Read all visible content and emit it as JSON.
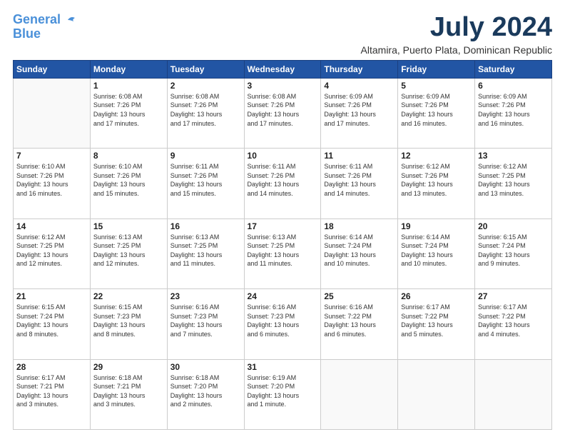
{
  "header": {
    "logo_line1": "General",
    "logo_line2": "Blue",
    "month": "July 2024",
    "location": "Altamira, Puerto Plata, Dominican Republic"
  },
  "weekdays": [
    "Sunday",
    "Monday",
    "Tuesday",
    "Wednesday",
    "Thursday",
    "Friday",
    "Saturday"
  ],
  "weeks": [
    [
      {
        "day": "",
        "info": ""
      },
      {
        "day": "1",
        "info": "Sunrise: 6:08 AM\nSunset: 7:26 PM\nDaylight: 13 hours\nand 17 minutes."
      },
      {
        "day": "2",
        "info": "Sunrise: 6:08 AM\nSunset: 7:26 PM\nDaylight: 13 hours\nand 17 minutes."
      },
      {
        "day": "3",
        "info": "Sunrise: 6:08 AM\nSunset: 7:26 PM\nDaylight: 13 hours\nand 17 minutes."
      },
      {
        "day": "4",
        "info": "Sunrise: 6:09 AM\nSunset: 7:26 PM\nDaylight: 13 hours\nand 17 minutes."
      },
      {
        "day": "5",
        "info": "Sunrise: 6:09 AM\nSunset: 7:26 PM\nDaylight: 13 hours\nand 16 minutes."
      },
      {
        "day": "6",
        "info": "Sunrise: 6:09 AM\nSunset: 7:26 PM\nDaylight: 13 hours\nand 16 minutes."
      }
    ],
    [
      {
        "day": "7",
        "info": "Sunrise: 6:10 AM\nSunset: 7:26 PM\nDaylight: 13 hours\nand 16 minutes."
      },
      {
        "day": "8",
        "info": "Sunrise: 6:10 AM\nSunset: 7:26 PM\nDaylight: 13 hours\nand 15 minutes."
      },
      {
        "day": "9",
        "info": "Sunrise: 6:11 AM\nSunset: 7:26 PM\nDaylight: 13 hours\nand 15 minutes."
      },
      {
        "day": "10",
        "info": "Sunrise: 6:11 AM\nSunset: 7:26 PM\nDaylight: 13 hours\nand 14 minutes."
      },
      {
        "day": "11",
        "info": "Sunrise: 6:11 AM\nSunset: 7:26 PM\nDaylight: 13 hours\nand 14 minutes."
      },
      {
        "day": "12",
        "info": "Sunrise: 6:12 AM\nSunset: 7:26 PM\nDaylight: 13 hours\nand 13 minutes."
      },
      {
        "day": "13",
        "info": "Sunrise: 6:12 AM\nSunset: 7:25 PM\nDaylight: 13 hours\nand 13 minutes."
      }
    ],
    [
      {
        "day": "14",
        "info": "Sunrise: 6:12 AM\nSunset: 7:25 PM\nDaylight: 13 hours\nand 12 minutes."
      },
      {
        "day": "15",
        "info": "Sunrise: 6:13 AM\nSunset: 7:25 PM\nDaylight: 13 hours\nand 12 minutes."
      },
      {
        "day": "16",
        "info": "Sunrise: 6:13 AM\nSunset: 7:25 PM\nDaylight: 13 hours\nand 11 minutes."
      },
      {
        "day": "17",
        "info": "Sunrise: 6:13 AM\nSunset: 7:25 PM\nDaylight: 13 hours\nand 11 minutes."
      },
      {
        "day": "18",
        "info": "Sunrise: 6:14 AM\nSunset: 7:24 PM\nDaylight: 13 hours\nand 10 minutes."
      },
      {
        "day": "19",
        "info": "Sunrise: 6:14 AM\nSunset: 7:24 PM\nDaylight: 13 hours\nand 10 minutes."
      },
      {
        "day": "20",
        "info": "Sunrise: 6:15 AM\nSunset: 7:24 PM\nDaylight: 13 hours\nand 9 minutes."
      }
    ],
    [
      {
        "day": "21",
        "info": "Sunrise: 6:15 AM\nSunset: 7:24 PM\nDaylight: 13 hours\nand 8 minutes."
      },
      {
        "day": "22",
        "info": "Sunrise: 6:15 AM\nSunset: 7:23 PM\nDaylight: 13 hours\nand 8 minutes."
      },
      {
        "day": "23",
        "info": "Sunrise: 6:16 AM\nSunset: 7:23 PM\nDaylight: 13 hours\nand 7 minutes."
      },
      {
        "day": "24",
        "info": "Sunrise: 6:16 AM\nSunset: 7:23 PM\nDaylight: 13 hours\nand 6 minutes."
      },
      {
        "day": "25",
        "info": "Sunrise: 6:16 AM\nSunset: 7:22 PM\nDaylight: 13 hours\nand 6 minutes."
      },
      {
        "day": "26",
        "info": "Sunrise: 6:17 AM\nSunset: 7:22 PM\nDaylight: 13 hours\nand 5 minutes."
      },
      {
        "day": "27",
        "info": "Sunrise: 6:17 AM\nSunset: 7:22 PM\nDaylight: 13 hours\nand 4 minutes."
      }
    ],
    [
      {
        "day": "28",
        "info": "Sunrise: 6:17 AM\nSunset: 7:21 PM\nDaylight: 13 hours\nand 3 minutes."
      },
      {
        "day": "29",
        "info": "Sunrise: 6:18 AM\nSunset: 7:21 PM\nDaylight: 13 hours\nand 3 minutes."
      },
      {
        "day": "30",
        "info": "Sunrise: 6:18 AM\nSunset: 7:20 PM\nDaylight: 13 hours\nand 2 minutes."
      },
      {
        "day": "31",
        "info": "Sunrise: 6:19 AM\nSunset: 7:20 PM\nDaylight: 13 hours\nand 1 minute."
      },
      {
        "day": "",
        "info": ""
      },
      {
        "day": "",
        "info": ""
      },
      {
        "day": "",
        "info": ""
      }
    ]
  ]
}
